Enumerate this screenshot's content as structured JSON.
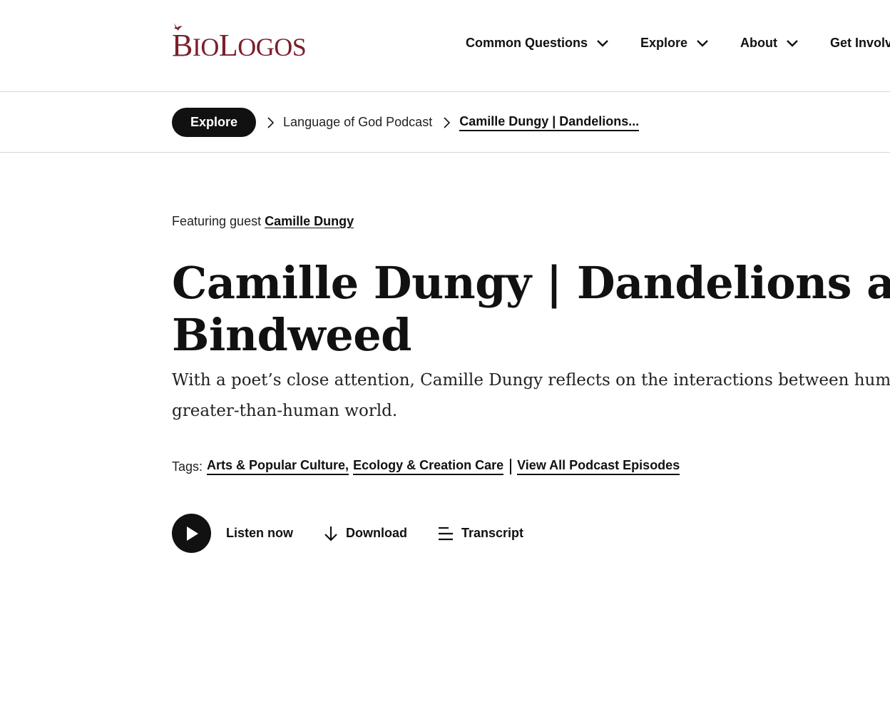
{
  "header": {
    "logo": {
      "text": "BioLogos",
      "brand_color": "#7a1f2b"
    },
    "nav": [
      {
        "label": "Common Questions",
        "icon": "chevron-down-icon"
      },
      {
        "label": "Explore",
        "icon": "chevron-down-icon"
      },
      {
        "label": "About",
        "icon": "chevron-down-icon"
      },
      {
        "label": "Get Involved"
      }
    ]
  },
  "breadcrumb": {
    "root": "Explore",
    "parent": "Language of God Podcast",
    "current": "Camille Dungy | Dandelions..."
  },
  "episode": {
    "featuring_prefix": "Featuring guest",
    "guest": "Camille Dungy",
    "title_line1": "Camille Dungy | Dandelions and",
    "title_line2": "Bindweed",
    "dek_line1": "With a poet’s close attention, Camille Dungy reflects on the interactions between humans and the",
    "dek_line2": "greater-than-human world.",
    "tags_label": "Tags:",
    "tags": [
      "Arts & Popular Culture,",
      "Ecology & Creation Care"
    ],
    "all_episodes_link": "View All Podcast Episodes"
  },
  "actions": {
    "listen": {
      "label": "Listen now",
      "icon": "play-icon"
    },
    "download": {
      "label": "Download",
      "icon": "download-arrow-icon"
    },
    "transcript": {
      "label": "Transcript",
      "icon": "transcript-lines-icon"
    }
  }
}
